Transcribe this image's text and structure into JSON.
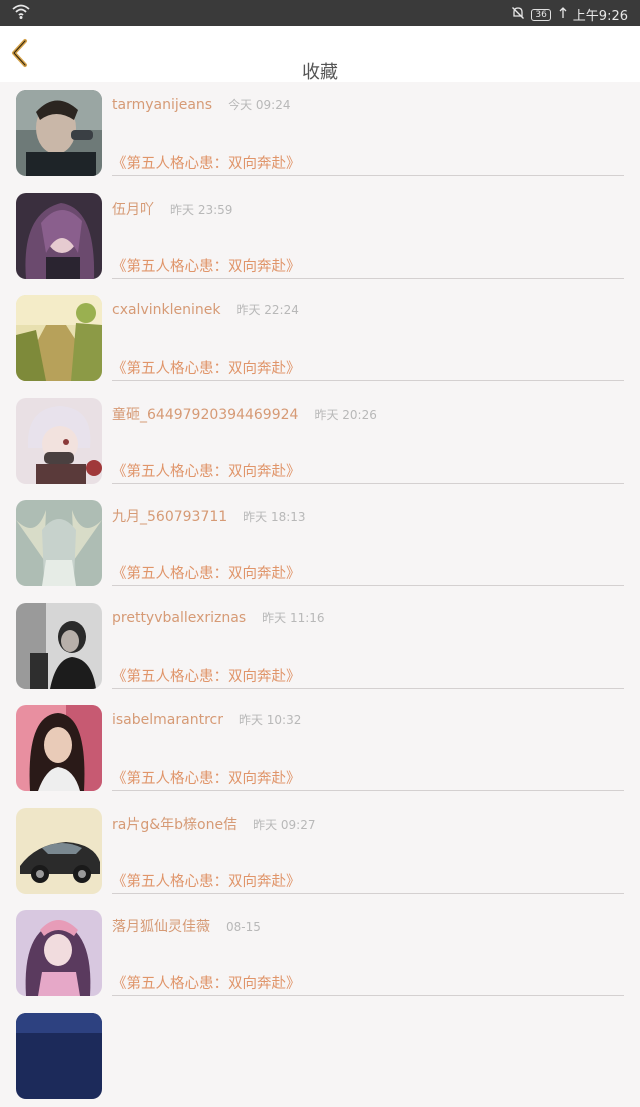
{
  "status_bar": {
    "battery": "36",
    "time": "上午9:26"
  },
  "header": {
    "title": "收藏"
  },
  "items": [
    {
      "name": "tarmyanijeans",
      "time": "今天 09:24",
      "book": "《第五人格心患：双向奔赴》"
    },
    {
      "name": "伍月吖",
      "time": "昨天 23:59",
      "book": "《第五人格心患：双向奔赴》"
    },
    {
      "name": "cxalvinkleninek",
      "time": "昨天 22:24",
      "book": "《第五人格心患：双向奔赴》"
    },
    {
      "name": "童砸_64497920394469924",
      "time": "昨天 20:26",
      "book": "《第五人格心患：双向奔赴》"
    },
    {
      "name": "九月_560793711",
      "time": "昨天 18:13",
      "book": "《第五人格心患：双向奔赴》"
    },
    {
      "name": "prettyvballexriznas",
      "time": "昨天 11:16",
      "book": "《第五人格心患：双向奔赴》"
    },
    {
      "name": "isabelmarantrcr",
      "time": "昨天 10:32",
      "book": "《第五人格心患：双向奔赴》"
    },
    {
      "name": "ra片g&年b榇one佶",
      "time": "昨天 09:27",
      "book": "《第五人格心患：双向奔赴》"
    },
    {
      "name": "落月狐仙灵佳薇",
      "time": "08-15",
      "book": "《第五人格心患：双向奔赴》"
    },
    {
      "name": "",
      "time": "",
      "book": ""
    }
  ],
  "colors": {
    "accent": "#e0956a",
    "name": "#d69a75",
    "back_arrow": "#d4a24a"
  }
}
